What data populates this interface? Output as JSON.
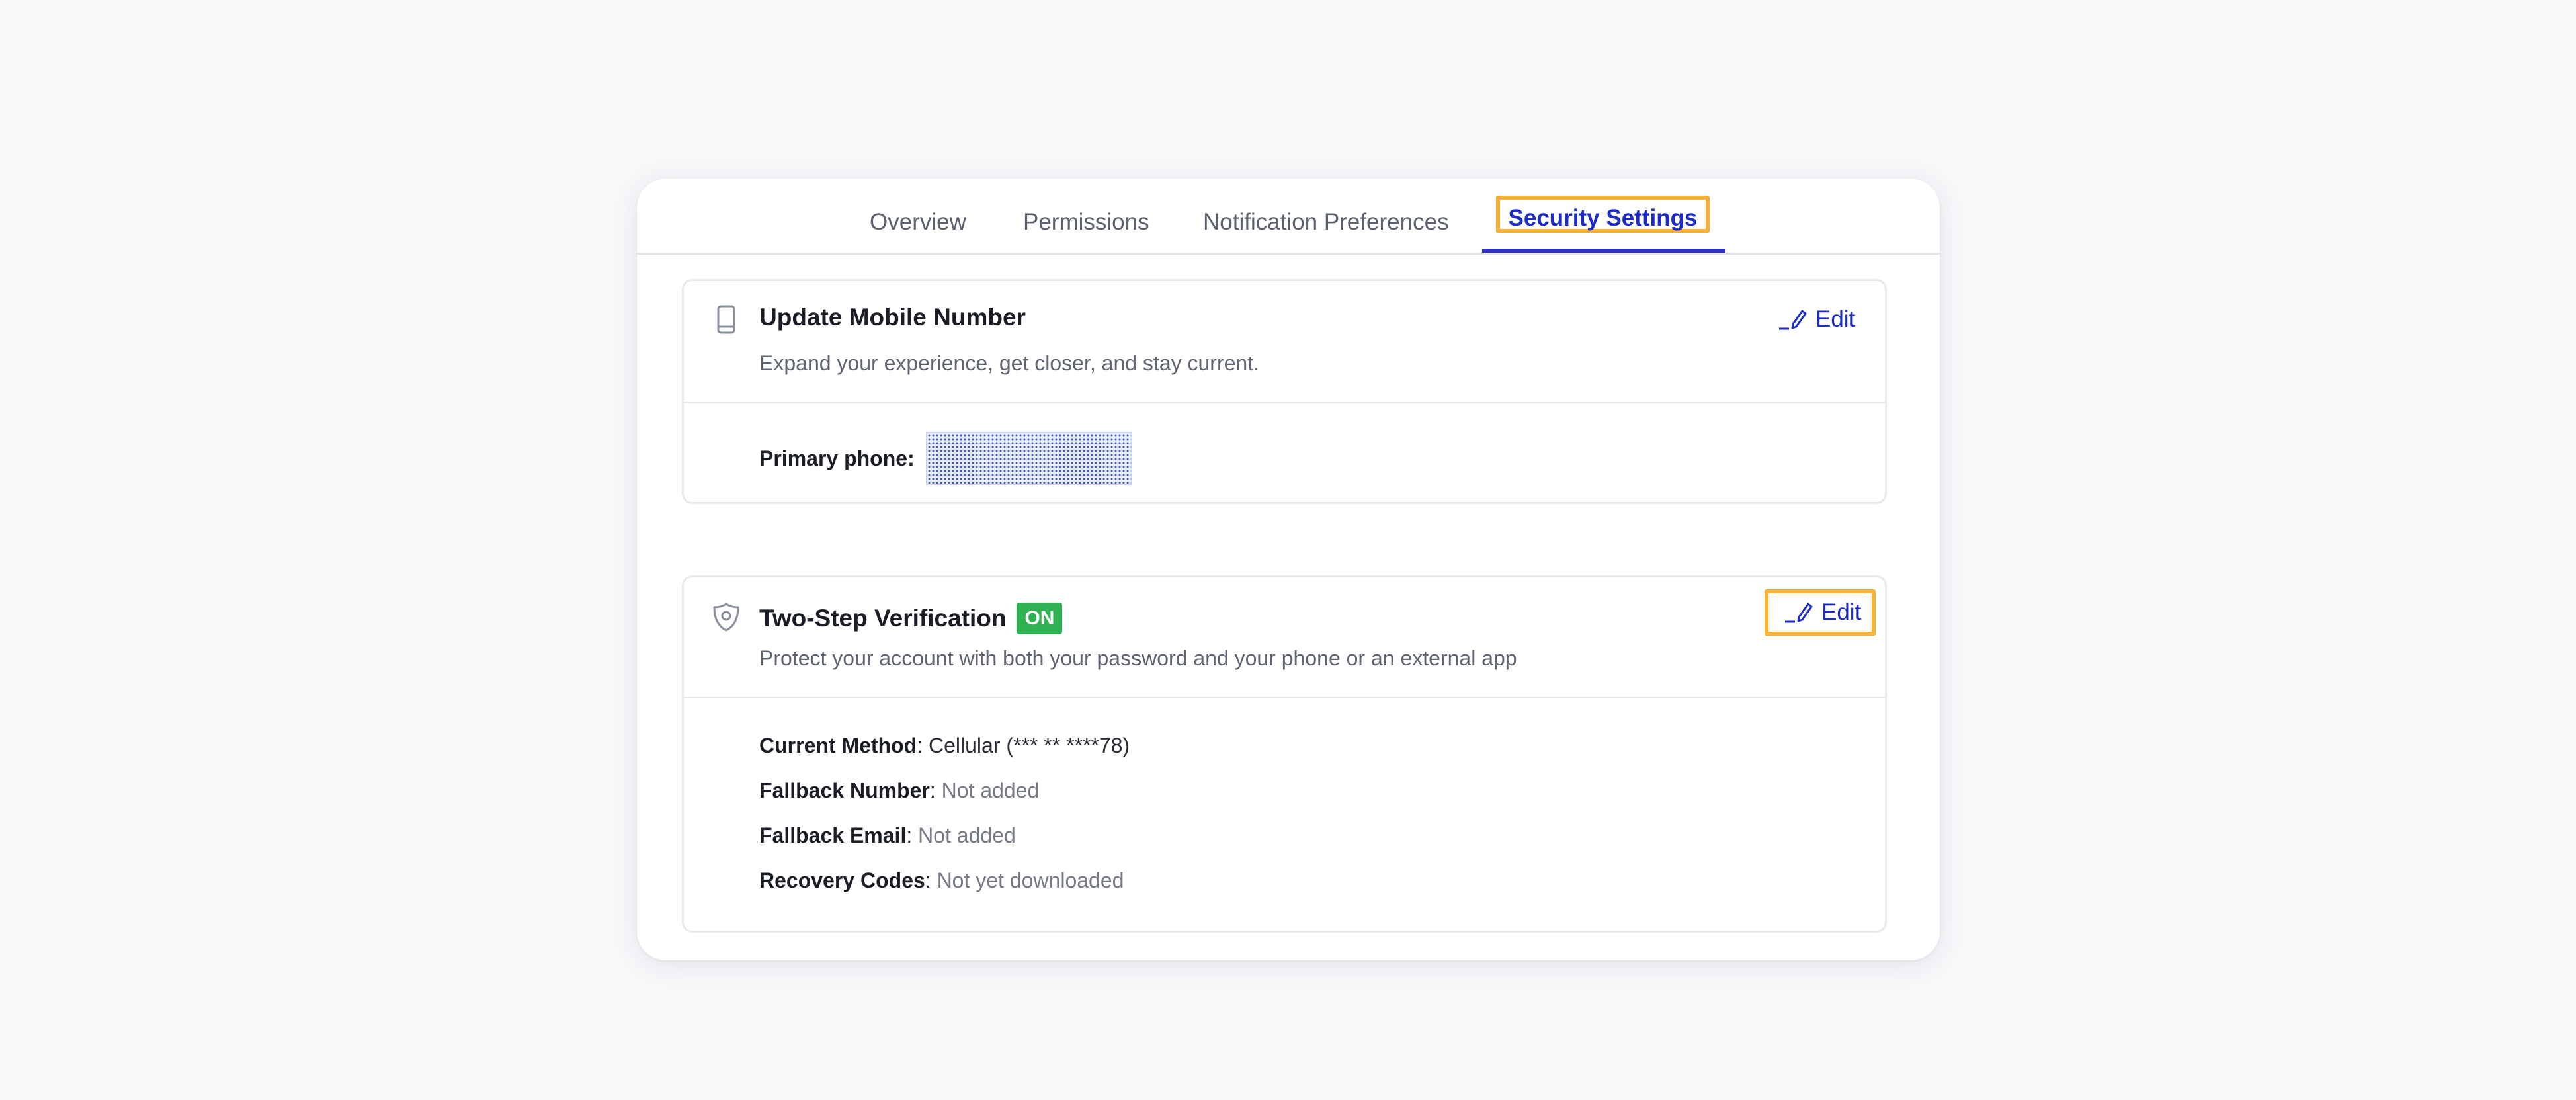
{
  "tabs": [
    {
      "label": "Overview"
    },
    {
      "label": "Permissions"
    },
    {
      "label": "Notification Preferences"
    },
    {
      "label": "Security Settings",
      "active": true
    }
  ],
  "mobile": {
    "title": "Update Mobile Number",
    "description": "Expand your experience, get closer, and stay current.",
    "edit_label": "Edit",
    "icon": "mobile-phone-icon",
    "primary_phone_label": "Primary phone:"
  },
  "two_step": {
    "title": "Two-Step Verification",
    "status_badge": "ON",
    "description": "Protect your account with both your password and your phone or an external app",
    "edit_label": "Edit",
    "icon": "shield-icon",
    "details": [
      {
        "key": "Current Method",
        "value": "Cellular (*** ** ****78)"
      },
      {
        "key": "Fallback Number",
        "value": "Not added"
      },
      {
        "key": "Fallback Email",
        "value": "Not added"
      },
      {
        "key": "Recovery Codes",
        "value": "Not yet downloaded"
      }
    ]
  },
  "colors": {
    "accent": "#1c2bc5",
    "highlight": "#f5b038",
    "status_on": "#2fb352"
  }
}
